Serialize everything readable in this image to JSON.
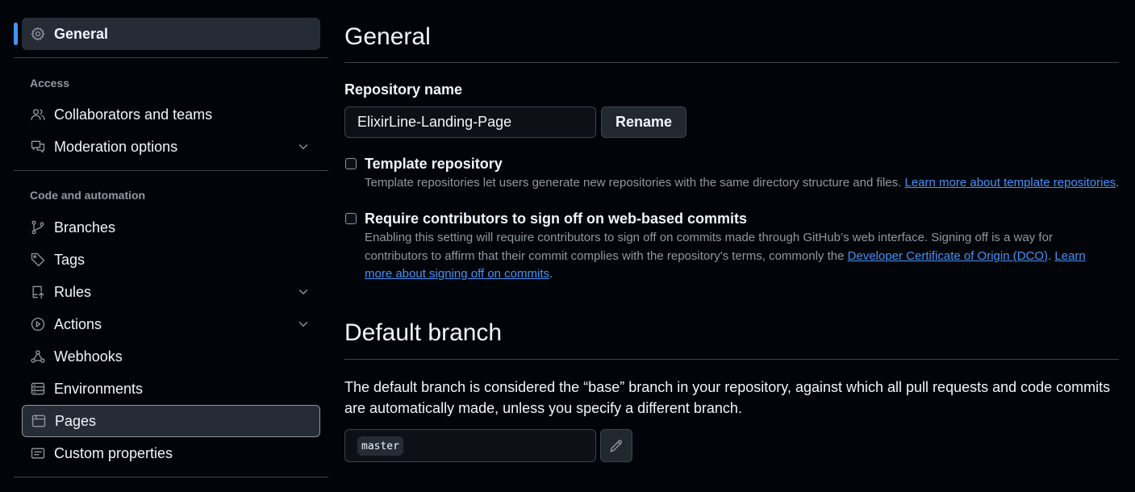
{
  "sidebar": {
    "top_item": {
      "label": "General",
      "icon": "gear-icon"
    },
    "sections": [
      {
        "heading": "Access",
        "items": [
          {
            "label": "Collaborators and teams",
            "icon": "people-icon"
          },
          {
            "label": "Moderation options",
            "icon": "comment-discussion-icon",
            "expandable": true
          }
        ]
      },
      {
        "heading": "Code and automation",
        "items": [
          {
            "label": "Branches",
            "icon": "git-branch-icon"
          },
          {
            "label": "Tags",
            "icon": "tag-icon"
          },
          {
            "label": "Rules",
            "icon": "repo-push-icon",
            "expandable": true
          },
          {
            "label": "Actions",
            "icon": "play-icon",
            "expandable": true
          },
          {
            "label": "Webhooks",
            "icon": "webhook-icon"
          },
          {
            "label": "Environments",
            "icon": "server-icon"
          },
          {
            "label": "Pages",
            "icon": "browser-icon",
            "selected": true
          },
          {
            "label": "Custom properties",
            "icon": "note-icon"
          }
        ]
      }
    ]
  },
  "general": {
    "title": "General",
    "repo_name_label": "Repository name",
    "repo_name_value": "ElixirLine-Landing-Page",
    "rename_label": "Rename",
    "template": {
      "title": "Template repository",
      "desc": "Template repositories let users generate new repositories with the same directory structure and files.",
      "link": "Learn more about template repositories",
      "tail": "."
    },
    "signoff": {
      "title": "Require contributors to sign off on web-based commits",
      "desc_line1": "Enabling this setting will require contributors to sign off on commits made through GitHub’s web interface. Signing off is a way for",
      "desc_line2": "contributors to affirm that their commit complies with the repository's terms, commonly the",
      "link_dco": "Developer Certificate of Origin (DCO)",
      "mid": ".",
      "link_learn_1": "Learn",
      "link_learn_2": "more about signing off on commits",
      "tail": "."
    }
  },
  "default_branch": {
    "title": "Default branch",
    "desc": "The default branch is considered the “base” branch in your repository, against which all pull requests and code commits are automatically made, unless you specify a different branch.",
    "branch": "master",
    "edit_icon": "pencil-icon"
  },
  "colors": {
    "background": "#010409",
    "accent": "#4493f8",
    "muted": "#9198a1",
    "border": "#3d444d"
  }
}
